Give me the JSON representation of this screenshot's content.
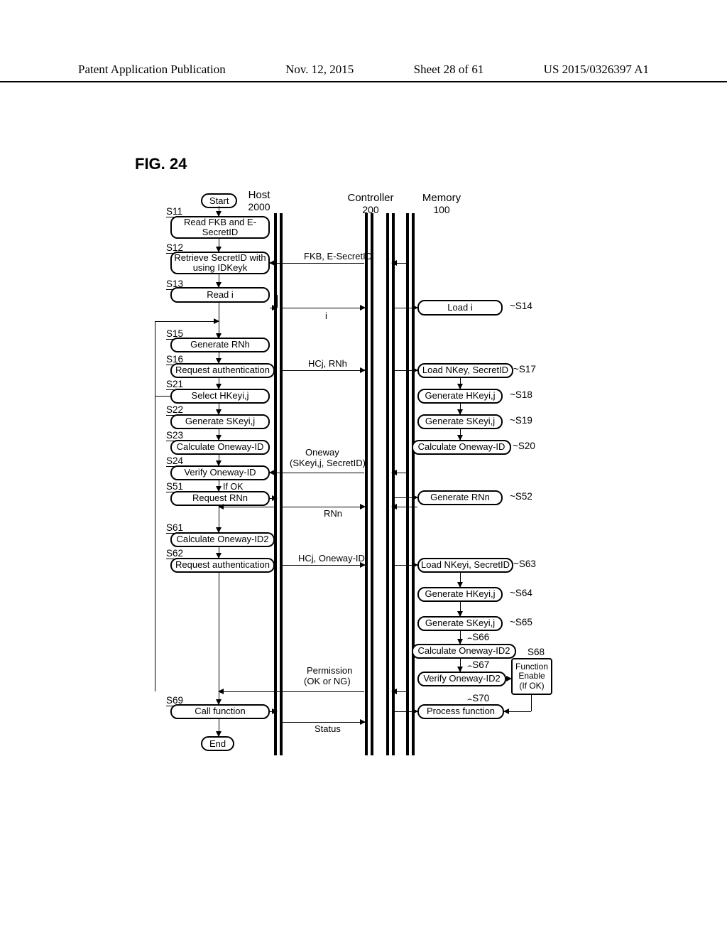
{
  "header": {
    "title": "Patent Application Publication",
    "date": "Nov. 12, 2015",
    "sheet": "Sheet 28 of 61",
    "pubno": "US 2015/0326397 A1"
  },
  "fig_title": "FIG.  24",
  "lanes": {
    "host": {
      "title": "Host",
      "num": "2000"
    },
    "ctrl": {
      "title": "Controller",
      "num": "200"
    },
    "mem": {
      "title": "Memory",
      "num": "100"
    }
  },
  "pills": {
    "start": "Start",
    "end": "End"
  },
  "host_boxes": {
    "s11": "Read FKB and E-SecretID",
    "s12": "Retrieve SecretID with using IDKeyk",
    "s13": "Read i",
    "s15": "Generate RNh",
    "s16": "Request authentication",
    "s21": "Select HKeyi,j",
    "s22": "Generate SKeyi,j",
    "s23": "Calculate Oneway-ID",
    "s24": "Verify Oneway-ID",
    "s51": "Request RNn",
    "s61": "Calculate Oneway-ID2",
    "s62": "Request authentication",
    "s69": "Call function"
  },
  "mem_boxes": {
    "s14": "Load i",
    "s17": "Load NKey, SecretID",
    "s18": "Generate HKeyi,j",
    "s19": "Generate SKeyi,j",
    "s20": "Calculate Oneway-ID",
    "s52": "Generate RNn",
    "s63": "Load NKeyi, SecretID",
    "s64": "Generate HKeyi,j",
    "s65": "Generate SKeyi,j",
    "s66": "Calculate Oneway-ID2",
    "s67": "Verify Oneway-ID2",
    "s70": "Process function"
  },
  "s68_box": {
    "l1": "Function",
    "l2": "Enable",
    "l3": "(If OK)"
  },
  "step_labels": {
    "s11": "S11",
    "s12": "S12",
    "s13": "S13",
    "s14": "S14",
    "s15": "S15",
    "s16": "S16",
    "s17": "S17",
    "s18": "S18",
    "s19": "S19",
    "s20": "S20",
    "s21": "S21",
    "s22": "S22",
    "s23": "S23",
    "s24": "S24",
    "s51": "S51",
    "s52": "S52",
    "s61": "S61",
    "s62": "S62",
    "s63": "S63",
    "s64": "S64",
    "s65": "S65",
    "s66": "S66",
    "s67": "S67",
    "s68": "S68",
    "s69": "S69",
    "s70": "S70"
  },
  "ifok": "If OK",
  "msgs": {
    "m1": "FKB, E-SecretID",
    "m2": "i",
    "m3": "HCj, RNh",
    "m4a": "Oneway",
    "m4b": "(SKeyi,j, SecretID)",
    "m5": "RNn",
    "m6": "HCj, Oneway-ID",
    "m7a": "Permission",
    "m7b": "(OK or NG)",
    "m8": "Status"
  },
  "chart_data": {
    "type": "table",
    "description": "Sequence/flow diagram with three swimlanes: Host 2000, Controller 200, Memory 100. Host executes steps S11–S13, S15–S16, S21–S24, S51, S61–S62, S69. Memory executes steps S14, S17–S20, S52, S63–S67, S70 and side box S68 (Function Enable If OK). Messages through Controller lane: 'FKB, E-SecretID' (Memory→Host at S12), 'i' (Host→Memory at S13/S14), 'HCj, RNh' (Host→Memory at S16/S17), 'Oneway (SKeyi,j, SecretID)' (Memory→Host at S20/S24), 'RNn' (Host→Memory at S51/S52 via Generate), 'HCj, Oneway-ID' (Host→Memory at S62/S63), 'Permission (OK or NG)' (Memory→Host after S67), 'Status' (Host→Memory at S69/S70). Loop-back arrow from after S24 to before S15. S67 feeds S68 (Function Enable) which feeds S70.",
    "lanes": [
      "Host 2000",
      "Controller 200",
      "Memory 100"
    ]
  }
}
